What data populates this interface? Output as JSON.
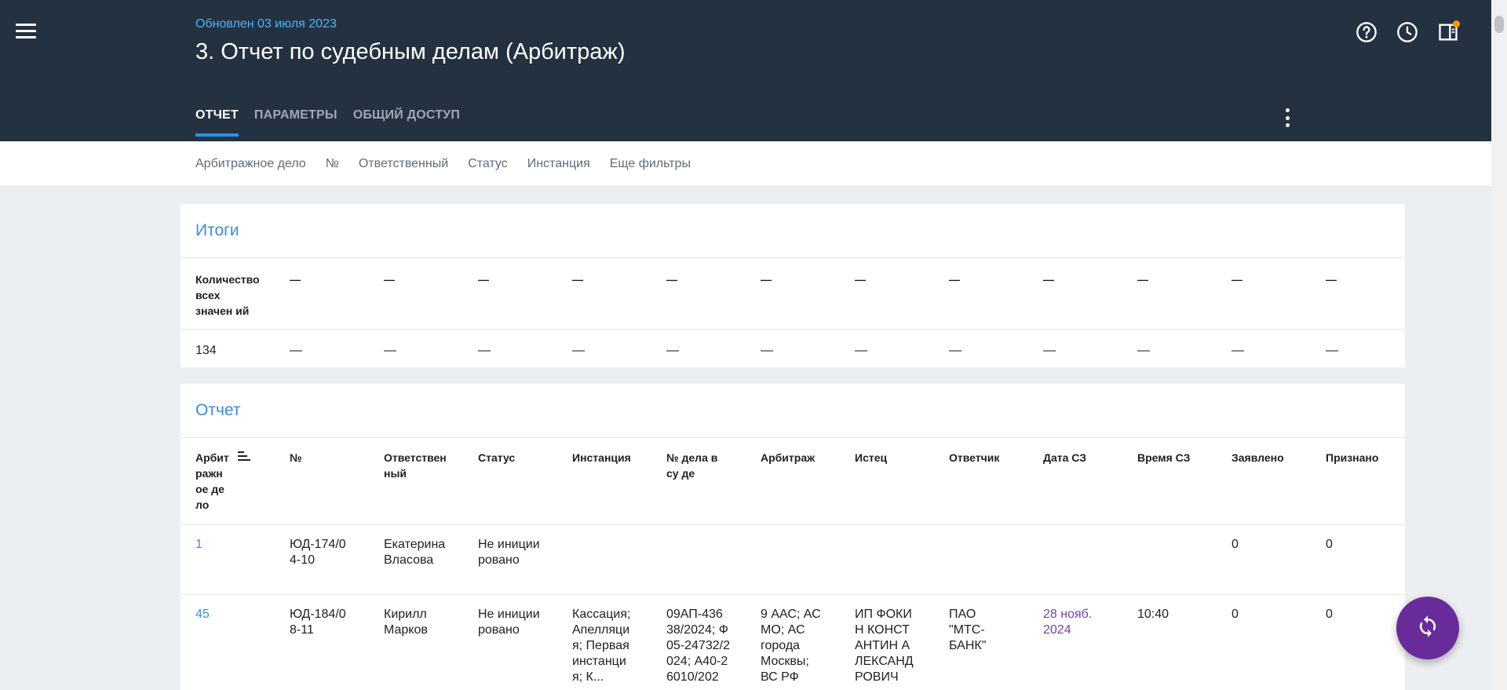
{
  "header": {
    "updated": "Обновлен 03 июля 2023",
    "title": "3. Отчет по судебным делам (Арбитраж)",
    "tabs": [
      {
        "label": "ОТЧЕТ",
        "active": true
      },
      {
        "label": "ПАРАМЕТРЫ",
        "active": false
      },
      {
        "label": "ОБЩИЙ ДОСТУП",
        "active": false
      }
    ],
    "icons": [
      "help-icon",
      "history-icon",
      "panel-icon",
      "more-vert-icon",
      "menu-icon"
    ]
  },
  "filters": [
    "Арбитражное дело",
    "№",
    "Ответственный",
    "Статус",
    "Инстанция",
    "Еще фильтры"
  ],
  "totals": {
    "title": "Итоги",
    "header": [
      "Количество всех значен ий",
      "—",
      "—",
      "—",
      "—",
      "—",
      "—",
      "—",
      "—",
      "—",
      "—",
      "—",
      "—"
    ],
    "values": [
      "134",
      "—",
      "—",
      "—",
      "—",
      "—",
      "—",
      "—",
      "—",
      "—",
      "—",
      "—",
      "—"
    ]
  },
  "report": {
    "title": "Отчет",
    "columns": [
      "Арбит ражн ое де ло",
      "№",
      "Ответствен ный",
      "Статус",
      "Инстанция",
      "№ дела в су де",
      "Арбитраж",
      "Истец",
      "Ответчик",
      "Дата СЗ",
      "Время СЗ",
      "Заявлено",
      "Признано"
    ],
    "rows": [
      [
        "1",
        "ЮД-174/0 4-10",
        "Екатерина Власова",
        "Не инициированo",
        "",
        "",
        "",
        "",
        "",
        "",
        "",
        "0",
        "0"
      ],
      [
        "45",
        "ЮД-184/0 8-11",
        "Кирилл Марков",
        "Не инициированo",
        "Кассация; Апелляция; Первая инстанция; К...",
        "09АП-436 38/2024; Ф05-24732/2024; А40-26010/202",
        "9 ААС; АС МО; АС города Москвы; ВС РФ",
        "ИП ФОКИН КОНСТАНТИН АЛЕКСАНДРОВИЧ",
        "ПАО \"МТС-БАНК\"",
        "28 нояб. 2024",
        "10:40",
        "0",
        "0"
      ]
    ]
  },
  "colors": {
    "header_bg": "#233140",
    "accent": "#2196f3",
    "link": "#3a8ee0",
    "fab": "#6a2b9a",
    "date": "#7b3fa6"
  }
}
